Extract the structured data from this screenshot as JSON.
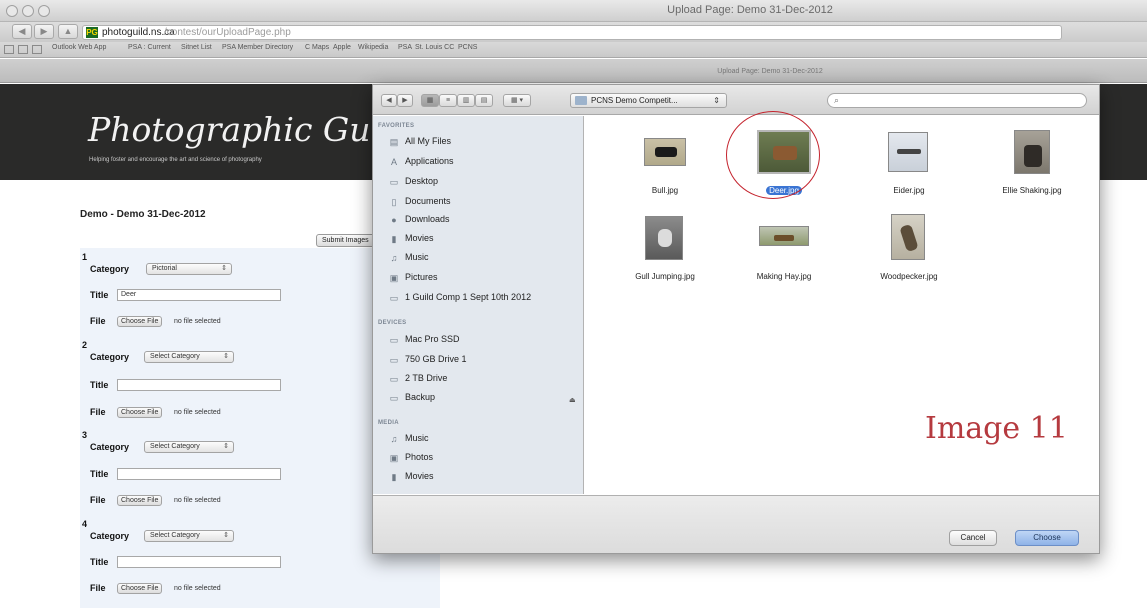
{
  "browser": {
    "window_title": "Upload Page: Demo 31-Dec-2012",
    "url_host": "photoguild.ns.ca",
    "url_path": "/contest/ourUploadPage.php",
    "favicon_text": "PG",
    "bookmarks": [
      "Outlook Web App",
      "PSA : Current",
      "Sitnet List",
      "PSA Member Directory",
      "C Maps",
      "Apple",
      "Wikipedia",
      "PSA",
      "St. Louis CC",
      "PCNS"
    ],
    "tab_title": "Upload Page: Demo 31-Dec-2012"
  },
  "site": {
    "title": "Photographic Guild",
    "tagline": "Helping foster and encourage the art and science of photography"
  },
  "form": {
    "heading": "Demo - Demo 31-Dec-2012",
    "submit_label": "Submit Images",
    "category_label": "Category",
    "title_label": "Title",
    "file_label": "File",
    "choose_file_label": "Choose File",
    "no_file_text": "no file selected",
    "entries": [
      {
        "number": "1",
        "category": "Pictorial",
        "title": "Deer"
      },
      {
        "number": "2",
        "category": "Select Category",
        "title": ""
      },
      {
        "number": "3",
        "category": "Select Category",
        "title": ""
      },
      {
        "number": "4",
        "category": "Select Category",
        "title": ""
      }
    ]
  },
  "dialog": {
    "path_folder": "PCNS Demo Competit...",
    "search_placeholder": "",
    "sidebar": {
      "favorites_header": "FAVORITES",
      "favorites": [
        "All My Files",
        "Applications",
        "Desktop",
        "Documents",
        "Downloads",
        "Movies",
        "Music",
        "Pictures",
        "1 Guild Comp 1 Sept 10th 2012"
      ],
      "devices_header": "DEVICES",
      "devices": [
        "Mac Pro SSD",
        "750 GB Drive 1",
        "2 TB Drive",
        "Backup"
      ],
      "media_header": "MEDIA",
      "media": [
        "Music",
        "Photos",
        "Movies"
      ]
    },
    "files": [
      "Bull.jpg",
      "Deer.jpg",
      "Eider.jpg",
      "Ellie Shaking.jpg",
      "Gull Jumping.jpg",
      "Making Hay.jpg",
      "Woodpecker.jpg"
    ],
    "selected_file": "Deer.jpg",
    "overlay_caption": "Image 11",
    "cancel_label": "Cancel",
    "choose_label": "Choose"
  },
  "colors": {
    "header_bg": "#2a2a29",
    "selection": "#3a74d3",
    "annotation": "#c4242e"
  }
}
